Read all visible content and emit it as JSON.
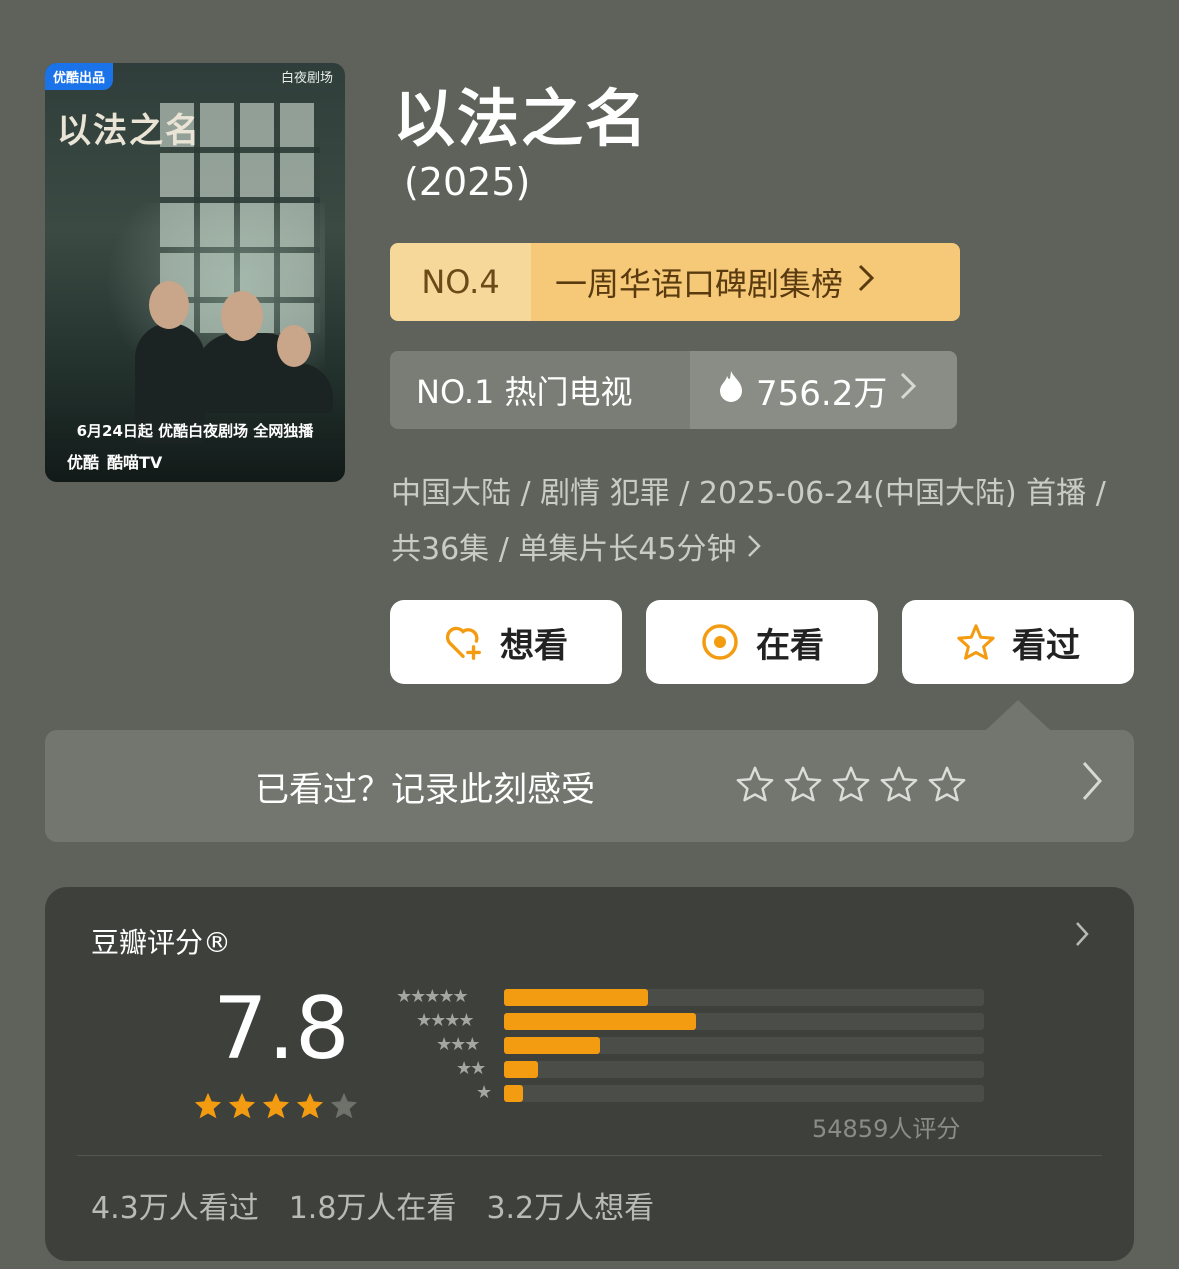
{
  "poster": {
    "badge": "优酷出品",
    "logo": "白夜剧场",
    "title_calligraphy": "以法之名",
    "release_line": "6月24日起 优酷白夜剧场 全网独播",
    "platform_youku": "优酷",
    "platform_kumiao": "酷喵TV"
  },
  "title": "以法之名",
  "year": "(2025)",
  "rank_primary": {
    "no": "NO.4",
    "name": "一周华语口碑剧集榜"
  },
  "rank_secondary": {
    "no": "NO.1 热门电视",
    "heat": "756.2万"
  },
  "meta": "中国大陆 / 剧情 犯罪 / 2025-06-24(中国大陆) 首播 / 共36集 / 单集片长45分钟",
  "actions": {
    "want": "想看",
    "watching": "在看",
    "watched": "看过"
  },
  "rate_prompt": "已看过？记录此刻感受",
  "douban": {
    "label": "豆瓣评分®",
    "score": "7.8",
    "stars_filled": 4,
    "count": "54859人评分",
    "distribution": [
      {
        "stars": 5,
        "percent": 30
      },
      {
        "stars": 4,
        "percent": 40
      },
      {
        "stars": 3,
        "percent": 20
      },
      {
        "stars": 2,
        "percent": 7
      },
      {
        "stars": 1,
        "percent": 4
      }
    ],
    "stats": {
      "watched": "4.3万人看过",
      "watching": "1.8万人在看",
      "want": "3.2万人想看"
    }
  },
  "colors": {
    "background": "#5f625a",
    "rank_gold": "#f6c978",
    "accent_orange": "#f39c12"
  }
}
